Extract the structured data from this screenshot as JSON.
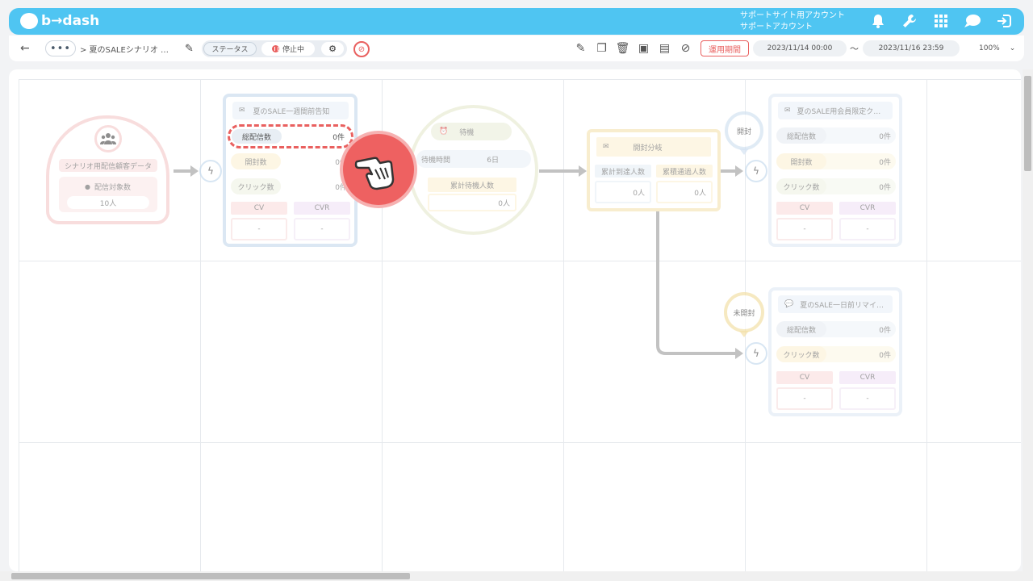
{
  "header": {
    "logo": "b→dash",
    "account_line1": "サポートサイト用アカウント",
    "account_line2": "サポートアカウント",
    "icons": [
      "bell-icon",
      "wrench-icon",
      "grid-icon",
      "chat-icon",
      "logout-icon"
    ]
  },
  "toolbar": {
    "back": "←",
    "more": "•••",
    "breadcrumb": "> 夏のSALEシナリオ …",
    "status_label": "ステータス",
    "status_value": "停止中",
    "period_label": "運用期間",
    "start_date": "2023/11/14 00:00",
    "tilde": "〜",
    "end_date": "2023/11/16 23:59",
    "zoom": "100%"
  },
  "colors": {
    "brand": "#4fc5f2",
    "alert": "#e9605f",
    "audience_border": "#f3c2c2",
    "mail_border": "#c8dcef",
    "wait_border": "#e2e6c8",
    "branch_border": "#f3e0a7"
  },
  "flow": {
    "audience": {
      "title": "シナリオ用配信顧客データ",
      "count_label": "配信対象数",
      "count_value": "10人"
    },
    "mail1": {
      "title": "夏のSALE一週間前告知",
      "sent_label": "総配信数",
      "sent_value": "0件",
      "open_label": "開封数",
      "open_value": "0件",
      "click_label": "クリック数",
      "click_value": "0件",
      "cv_label": "CV",
      "cv_value": "-",
      "cvr_label": "CVR",
      "cvr_value": "-"
    },
    "wait": {
      "title": "待機",
      "time_label": "待機時間",
      "time_value": "6日",
      "total_label": "累計待機人数",
      "total_value": "0人"
    },
    "branch": {
      "title": "開封分岐",
      "reach_label": "累計到達人数",
      "reach_value": "0人",
      "pass_label": "累積通過人数",
      "pass_value": "0人"
    },
    "open_tag": "開封",
    "unopen_tag": "未開封",
    "mail2": {
      "title": "夏のSALE用会員限定ク…",
      "sent_label": "総配信数",
      "sent_value": "0件",
      "open_label": "開封数",
      "open_value": "0件",
      "click_label": "クリック数",
      "click_value": "0件",
      "cv_label": "CV",
      "cv_value": "-",
      "cvr_label": "CVR",
      "cvr_value": "-"
    },
    "mail3": {
      "title": "夏のSALE一日前リマイ…",
      "sent_label": "総配信数",
      "sent_value": "0件",
      "click_label": "クリック数",
      "click_value": "0件",
      "cv_label": "CV",
      "cv_value": "-",
      "cvr_label": "CVR",
      "cvr_value": "-"
    }
  }
}
